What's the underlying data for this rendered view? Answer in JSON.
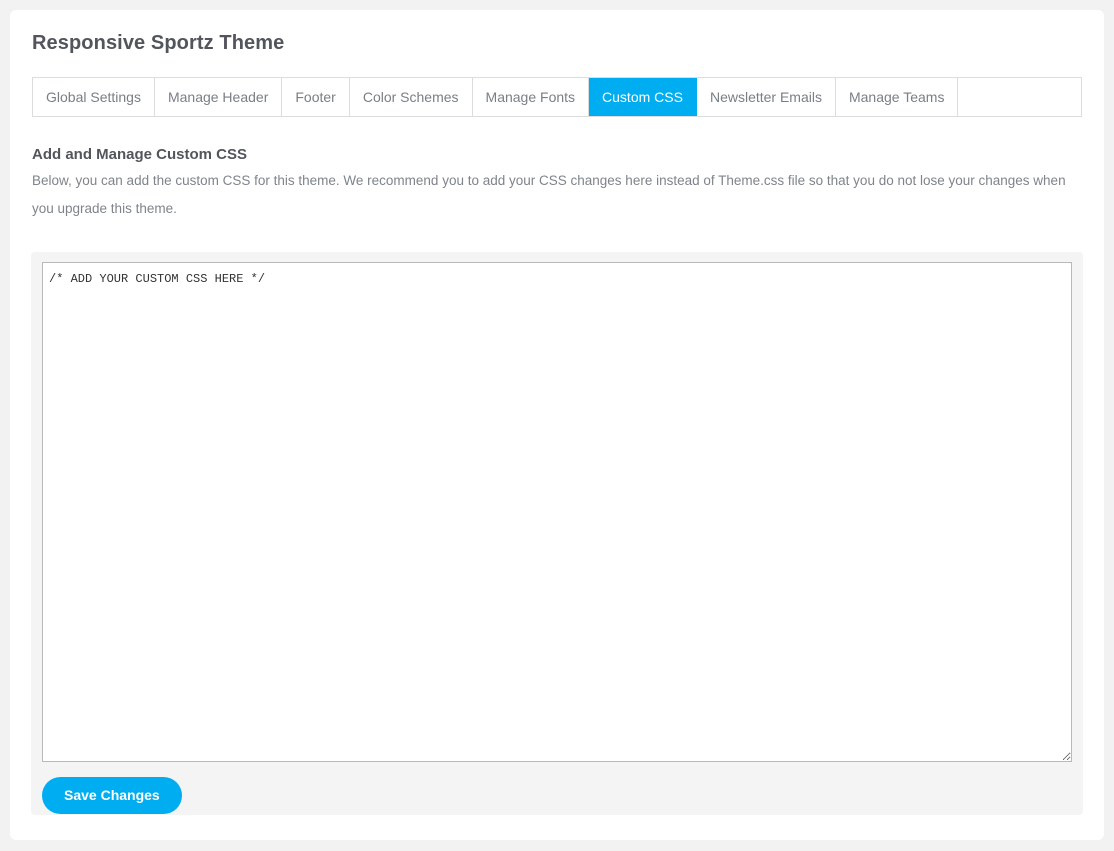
{
  "page": {
    "title": "Responsive Sportz Theme",
    "background_color": "#f2f2f2",
    "accent_color": "#00adf0"
  },
  "tabs": [
    {
      "label": "Global Settings",
      "active": false
    },
    {
      "label": "Manage Header",
      "active": false
    },
    {
      "label": "Footer",
      "active": false
    },
    {
      "label": "Color Schemes",
      "active": false
    },
    {
      "label": "Manage Fonts",
      "active": false
    },
    {
      "label": "Custom CSS",
      "active": true
    },
    {
      "label": "Newsletter Emails",
      "active": false
    },
    {
      "label": "Manage Teams",
      "active": false
    }
  ],
  "section": {
    "heading": "Add and Manage Custom CSS",
    "description": "Below, you can add the custom CSS for this theme. We recommend you to add your CSS changes here instead of Theme.css file so that you do not lose your changes when you upgrade this theme."
  },
  "editor": {
    "value": "/* ADD YOUR CUSTOM CSS HERE */",
    "placeholder": "/* ADD YOUR CUSTOM CSS HERE */"
  },
  "actions": {
    "save_label": "Save Changes"
  }
}
